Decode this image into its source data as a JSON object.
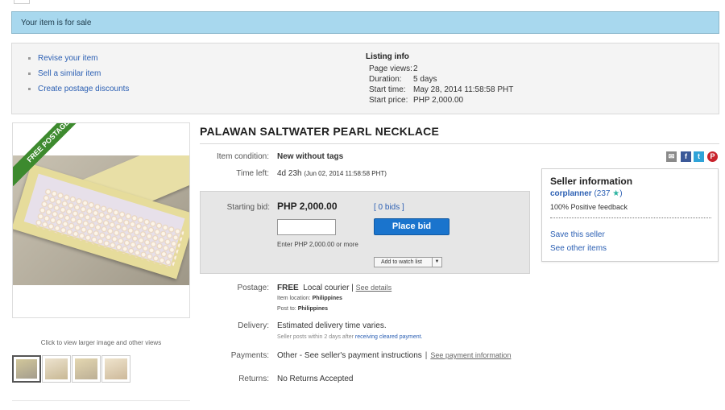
{
  "banner": {
    "text": "Your item is for sale"
  },
  "actions": [
    {
      "label": "Revise your item"
    },
    {
      "label": "Sell a similar item"
    },
    {
      "label": "Create postage discounts"
    }
  ],
  "listing_info": {
    "title": "Listing info",
    "rows": [
      {
        "key": "Page views:",
        "value": "2"
      },
      {
        "key": "Duration:",
        "value": "5 days"
      },
      {
        "key": "Start time:",
        "value": "May 28, 2014 11:58:58 PHT"
      },
      {
        "key": "Start price:",
        "value": "PHP 2,000.00"
      }
    ]
  },
  "image": {
    "ribbon": "FREE POSTAGE",
    "caption": "Click to view larger image and other views",
    "thumbnail_count": 4
  },
  "item": {
    "title": "PALAWAN SALTWATER PEARL NECKLACE",
    "condition_label": "Item condition:",
    "condition_value": "New without tags",
    "time_left_label": "Time left:",
    "time_left_value": "4d 23h",
    "time_left_detail": "(Jun 02, 2014   11:58:58 PHT)"
  },
  "bid": {
    "label": "Starting bid:",
    "price": "PHP 2,000.00",
    "bids_link": "[ 0 bids ]",
    "button": "Place bid",
    "hint": "Enter PHP 2,000.00 or more",
    "watch": "Add to watch list"
  },
  "postage": {
    "label": "Postage:",
    "free": "FREE",
    "method": "Local courier |",
    "details_link": "See details",
    "location_label": "Item location:",
    "location_value": "Philippines",
    "post_to_label": "Post to:",
    "post_to_value": "Philippines"
  },
  "delivery": {
    "label": "Delivery:",
    "value": "Estimated delivery time varies.",
    "note": "Seller posts within 2 days after",
    "note_link": "receiving cleared payment."
  },
  "payments": {
    "label": "Payments:",
    "value": "Other - See seller's payment instructions",
    "sep": "|",
    "link": "See payment information"
  },
  "returns": {
    "label": "Returns:",
    "value": "No Returns Accepted"
  },
  "share_icons": [
    "mail-icon",
    "facebook-icon",
    "twitter-icon",
    "pinterest-icon"
  ],
  "seller": {
    "title": "Seller information",
    "name": "corplanner",
    "score_open": "(237",
    "score_close": ")",
    "feedback": "100% Positive feedback",
    "save": "Save this seller",
    "other": "See other items"
  },
  "colors": {
    "banner": "#a8d8ee",
    "link": "#2b5fb3",
    "bid_button": "#1a74cd",
    "ribbon": "#3d8a2e"
  }
}
